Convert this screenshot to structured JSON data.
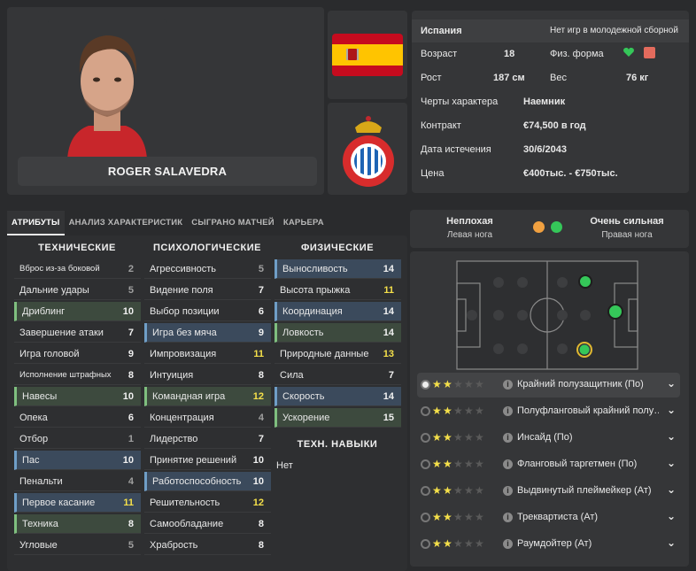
{
  "player": {
    "name": "ROGER SALAVEDRA"
  },
  "info": {
    "nation": "Испания",
    "youth_caps": "Нет игр в молодежной сборной",
    "age_label": "Возраст",
    "age": "18",
    "fitness_label": "Физ. форма",
    "height_label": "Рост",
    "height": "187 см",
    "weight_label": "Вес",
    "weight": "76 кг",
    "traits_label": "Черты характера",
    "traits": "Наемник",
    "contract_label": "Контракт",
    "contract": "€74,500 в год",
    "expiry_label": "Дата истечения",
    "expiry": "30/6/2043",
    "value_label": "Цена",
    "value": "€400тыс. - €750тыс."
  },
  "tabs": [
    "АТРИБУТЫ",
    "АНАЛИЗ ХАРАКТЕРИСТИК",
    "СЫГРАНО МАТЧЕЙ",
    "КАРЬЕРА"
  ],
  "columns": {
    "technical": "ТЕХНИЧЕСКИЕ",
    "mental": "ПСИХОЛОГИЧЕСКИЕ",
    "physical": "ФИЗИЧЕСКИЕ",
    "tech_skills": "ТЕХН. НАВЫКИ",
    "tech_skills_value": "Нет"
  },
  "technical": [
    {
      "label": "Вброс из-за боковой",
      "value": "2"
    },
    {
      "label": "Дальние удары",
      "value": "5"
    },
    {
      "label": "Дриблинг",
      "value": "10"
    },
    {
      "label": "Завершение атаки",
      "value": "7"
    },
    {
      "label": "Игра головой",
      "value": "9"
    },
    {
      "label": "Исполнение штрафных",
      "value": "8"
    },
    {
      "label": "Навесы",
      "value": "10"
    },
    {
      "label": "Опека",
      "value": "6"
    },
    {
      "label": "Отбор",
      "value": "1"
    },
    {
      "label": "Пас",
      "value": "10"
    },
    {
      "label": "Пенальти",
      "value": "4"
    },
    {
      "label": "Первое касание",
      "value": "11"
    },
    {
      "label": "Техника",
      "value": "8"
    },
    {
      "label": "Угловые",
      "value": "5"
    }
  ],
  "mental": [
    {
      "label": "Агрессивность",
      "value": "5"
    },
    {
      "label": "Видение поля",
      "value": "7"
    },
    {
      "label": "Выбор позиции",
      "value": "6"
    },
    {
      "label": "Игра без мяча",
      "value": "9"
    },
    {
      "label": "Импровизация",
      "value": "11"
    },
    {
      "label": "Интуиция",
      "value": "8"
    },
    {
      "label": "Командная игра",
      "value": "12"
    },
    {
      "label": "Концентрация",
      "value": "4"
    },
    {
      "label": "Лидерство",
      "value": "7"
    },
    {
      "label": "Принятие решений",
      "value": "10"
    },
    {
      "label": "Работоспособность",
      "value": "10"
    },
    {
      "label": "Решительность",
      "value": "12"
    },
    {
      "label": "Самообладание",
      "value": "8"
    },
    {
      "label": "Храбрость",
      "value": "8"
    }
  ],
  "physical": [
    {
      "label": "Выносливость",
      "value": "14"
    },
    {
      "label": "Высота прыжка",
      "value": "11"
    },
    {
      "label": "Координация",
      "value": "14"
    },
    {
      "label": "Ловкость",
      "value": "14"
    },
    {
      "label": "Природные данные",
      "value": "13"
    },
    {
      "label": "Сила",
      "value": "7"
    },
    {
      "label": "Скорость",
      "value": "14"
    },
    {
      "label": "Ускорение",
      "value": "15"
    }
  ],
  "foot": {
    "left_rating": "Неплохая",
    "left_label": "Левая нога",
    "right_rating": "Очень сильная",
    "right_label": "Правая нога"
  },
  "roles": [
    {
      "label": "Крайний полузащитник (По)",
      "stars": 2
    },
    {
      "label": "Полуфланговый крайний полу…",
      "stars": 2
    },
    {
      "label": "Инсайд (По)",
      "stars": 2
    },
    {
      "label": "Фланговый таргетмен (По)",
      "stars": 2
    },
    {
      "label": "Выдвинутый плеймейкер (Ат)",
      "stars": 2
    },
    {
      "label": "Треквартиста (Ат)",
      "stars": 2
    },
    {
      "label": "Раумдойтер (Ат)",
      "stars": 2
    }
  ],
  "colors": {
    "accent_yellow": "#f5e04a",
    "value_white": "#f0f0f0",
    "value_grey": "#a0a0a0",
    "green": "#35c759",
    "orange": "#f0a040"
  }
}
